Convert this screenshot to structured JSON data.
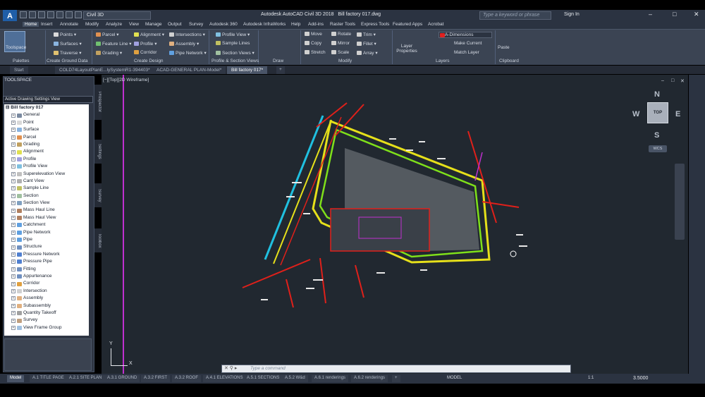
{
  "window": {
    "title": "Autodesk AutoCAD Civil 3D 2018",
    "file": "Bill factory 017.dwg",
    "workspace": "Civil 3D",
    "search_placeholder": "Type a keyword or phrase",
    "signin": "Sign In"
  },
  "menu": [
    "Home",
    "Insert",
    "Annotate",
    "Modify",
    "Analyze",
    "View",
    "Manage",
    "Output",
    "Survey",
    "Autodesk 360",
    "Autodesk InfraWorks",
    "Help",
    "Add-ins",
    "Raster Tools",
    "Express Tools",
    "Featured Apps",
    "Acrobat"
  ],
  "ribbon": {
    "toolspace": "Toolspace",
    "items": {
      "points": "Points",
      "surfaces": "Surfaces",
      "traverse": "Traverse",
      "parcel": "Parcel",
      "feature_line": "Feature Line",
      "grading": "Grading",
      "alignment": "Alignment",
      "profile": "Profile",
      "corridor": "Corridor",
      "intersections": "Intersections",
      "assembly": "Assembly",
      "pipe_network": "Pipe Network",
      "profile_view": "Profile View",
      "sample_lines": "Sample Lines",
      "section_views": "Section Views",
      "move": "Move",
      "copy": "Copy",
      "stretch": "Stretch",
      "rotate": "Rotate",
      "mirror": "Mirror",
      "scale": "Scale",
      "trim": "Trim",
      "fillet": "Fillet",
      "array": "Array",
      "layer_properties": "Layer Properties",
      "layer_name": "A-Dimensions",
      "make_current": "Make Current",
      "match_layer": "Match Layer",
      "paste": "Paste"
    },
    "panels": [
      "Palettes",
      "Create Ground Data",
      "Create Design",
      "Profile & Section Views",
      "Draw",
      "Modify",
      "Layers",
      "Clipboard"
    ]
  },
  "doc_tabs": [
    "Start",
    "COLD74LayoutPlanE...lySystemR1-394403*",
    "ACAD-GENERAL PLAN-Model*",
    "Bill factory 017*"
  ],
  "toolspace": {
    "title": "TOOLSPACE",
    "view_select": "Active Drawing Settings View",
    "root": "Bill factory 017",
    "items": [
      "General",
      "Point",
      "Surface",
      "Parcel",
      "Grading",
      "Alignment",
      "Profile",
      "Profile View",
      "Superelevation View",
      "Cant View",
      "Sample Line",
      "Section",
      "Section View",
      "Mass Haul Line",
      "Mass Haul View",
      "Catchment",
      "Pipe Network",
      "Pipe",
      "Structure",
      "Pressure Network",
      "Pressure Pipe",
      "Fitting",
      "Appurtenance",
      "Corridor",
      "Intersection",
      "Assembly",
      "Subassembly",
      "Quantity Takeoff",
      "Survey",
      "View Frame Group"
    ],
    "side_tabs": [
      "Prospector",
      "Settings",
      "Survey",
      "Toolbox"
    ]
  },
  "canvas": {
    "view_label": "[−][Top][2D Wireframe]",
    "viewcube_face": "TOP",
    "compass": {
      "n": "N",
      "s": "S",
      "e": "E",
      "w": "W"
    },
    "wcs": "WCS",
    "ucs_y": "Y",
    "ucs_x": "X"
  },
  "command_line": {
    "placeholder": "Type a command"
  },
  "layout_tabs": [
    "Model",
    "A.1 TITLE PAGE",
    "A.2.1 SITE PLAN",
    "A.3.1 GROUND",
    "A.3.2 FIRST",
    "A.3.2 ROOF",
    "A.4.1 ELEVATIONS",
    "A.5.1 SECTIONS",
    "A.5.2 W&d",
    "A.6.1 renderings",
    "A.6.2 renderings"
  ],
  "status": {
    "mode": "MODEL",
    "scale": "1:1",
    "value": "3.5000"
  },
  "colors": {
    "canvas_bg": "#212830",
    "yellow": "#e6e01a",
    "green": "#7fe01a",
    "red": "#e0201a",
    "magenta": "#c030d0",
    "cyan": "#20c0e0"
  }
}
